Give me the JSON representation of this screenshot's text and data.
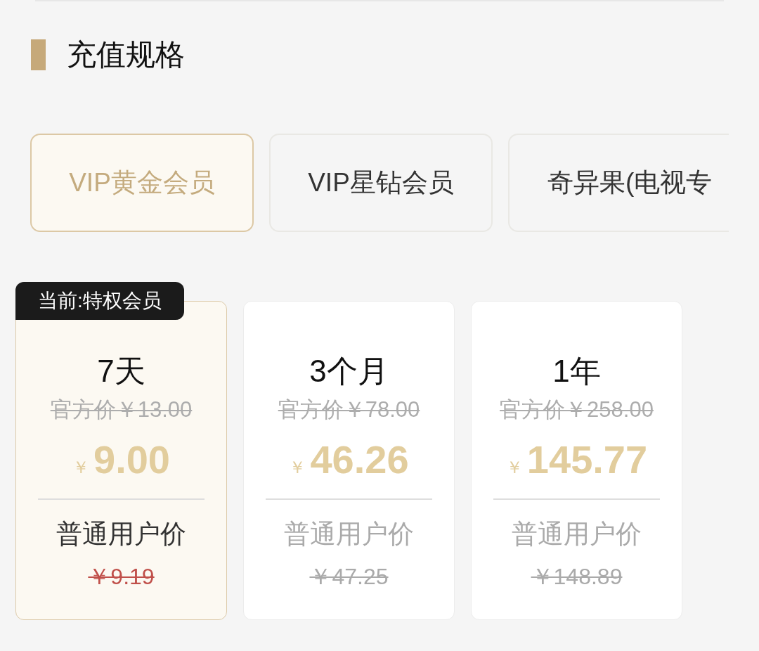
{
  "section": {
    "title": "充值规格"
  },
  "tabs": [
    {
      "label": "VIP黄金会员",
      "selected": true
    },
    {
      "label": "VIP星钻会员",
      "selected": false
    },
    {
      "label": "奇异果(电视专",
      "selected": false
    }
  ],
  "plans": [
    {
      "badge": "当前:特权会员",
      "duration": "7天",
      "official_price": "官方价￥13.00",
      "currency": "￥",
      "price": "9.00",
      "regular_label": "普通用户价",
      "regular_price": "￥9.19",
      "selected": true
    },
    {
      "duration": "3个月",
      "official_price": "官方价￥78.00",
      "currency": "￥",
      "price": "46.26",
      "regular_label": "普通用户价",
      "regular_price": "￥47.25",
      "selected": false
    },
    {
      "duration": "1年",
      "official_price": "官方价￥258.00",
      "currency": "￥",
      "price": "145.77",
      "regular_label": "普通用户价",
      "regular_price": "￥148.89",
      "selected": false
    }
  ]
}
